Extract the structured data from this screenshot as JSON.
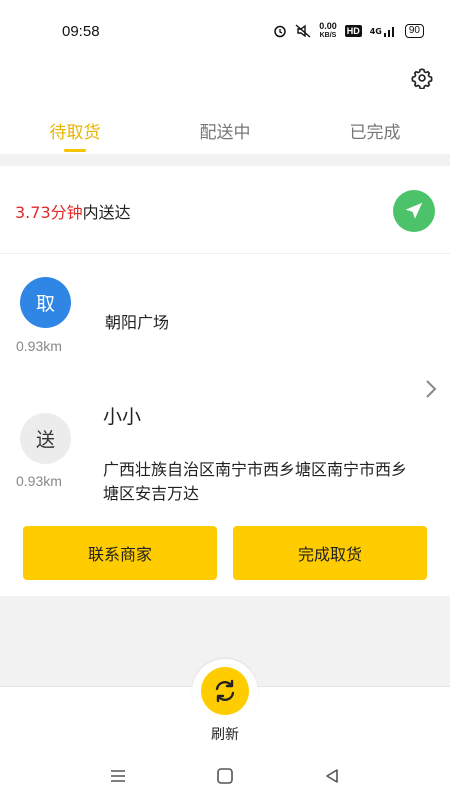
{
  "status_bar": {
    "time": "09:58",
    "net_speed_value": "0.00",
    "net_speed_unit": "KB/S",
    "hd": "HD",
    "signal": "4G",
    "battery": "90"
  },
  "tabs": [
    {
      "label": "待取货",
      "active": true
    },
    {
      "label": "配送中",
      "active": false
    },
    {
      "label": "已完成",
      "active": false
    }
  ],
  "order": {
    "eta_value": "3.73分钟",
    "eta_suffix": "内送达",
    "pickup": {
      "badge": "取",
      "distance": "0.93km",
      "name": "朝阳广场"
    },
    "dropoff": {
      "badge": "送",
      "distance": "0.93km",
      "name": "小小",
      "address": "广西壮族自治区南宁市西乡塘区南宁市西乡塘区安吉万达"
    },
    "buttons": {
      "contact": "联系商家",
      "finish": "完成取货"
    }
  },
  "bottom": {
    "refresh_label": "刷新"
  },
  "colors": {
    "accent": "#ffcc00",
    "active_tab": "#e8b400",
    "eta_red": "#e02a2a",
    "nav_green": "#4cc26a",
    "pickup_blue": "#2f86e4"
  }
}
